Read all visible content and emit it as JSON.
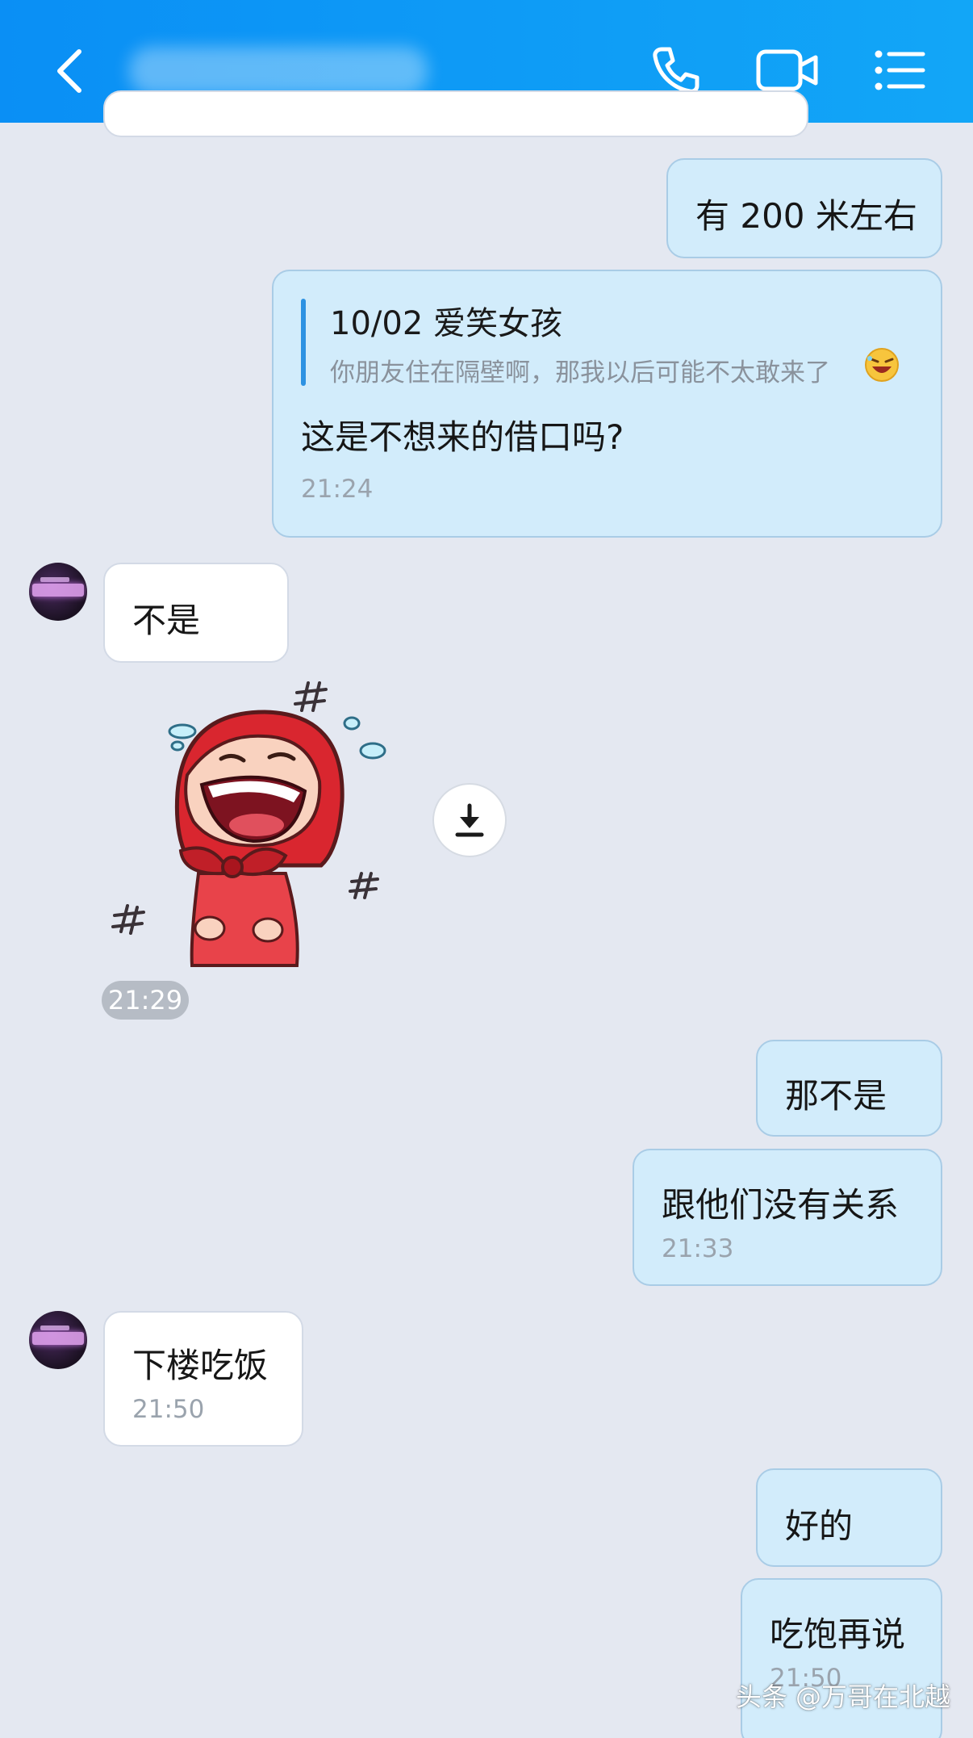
{
  "header": {
    "back_icon": "chevron-left-icon",
    "call_icon": "phone-icon",
    "video_icon": "video-camera-icon",
    "menu_icon": "list-menu-icon",
    "bg_color": "#0a8ff5"
  },
  "messages": {
    "m1": {
      "text": "有 200 米左右"
    },
    "m2": {
      "quote_title": "10/02 爱笑女孩",
      "quote_text": "你朋友住在隔壁啊，那我以后可能不太敢来了",
      "text": "这是不想来的借口吗?",
      "time": "21:24"
    },
    "m3": {
      "text": "不是"
    },
    "m4": {
      "sticker": "laughing-red-hood-girl-sticker",
      "time": "21:29"
    },
    "m5": {
      "text": "那不是"
    },
    "m6": {
      "text": "跟他们没有关系",
      "time": "21:33"
    },
    "m7": {
      "text": "下楼吃饭",
      "time": "21:50"
    },
    "m8": {
      "text": "好的"
    },
    "m9": {
      "text": "吃饱再说",
      "time": "21:50"
    }
  },
  "watermark": "头条 @万哥在北越",
  "colors": {
    "outgoing_bubble": "#d2ecfb",
    "incoming_bubble": "#ffffff",
    "chat_background": "#e4e8f1",
    "quote_bar": "#2d92e2"
  }
}
